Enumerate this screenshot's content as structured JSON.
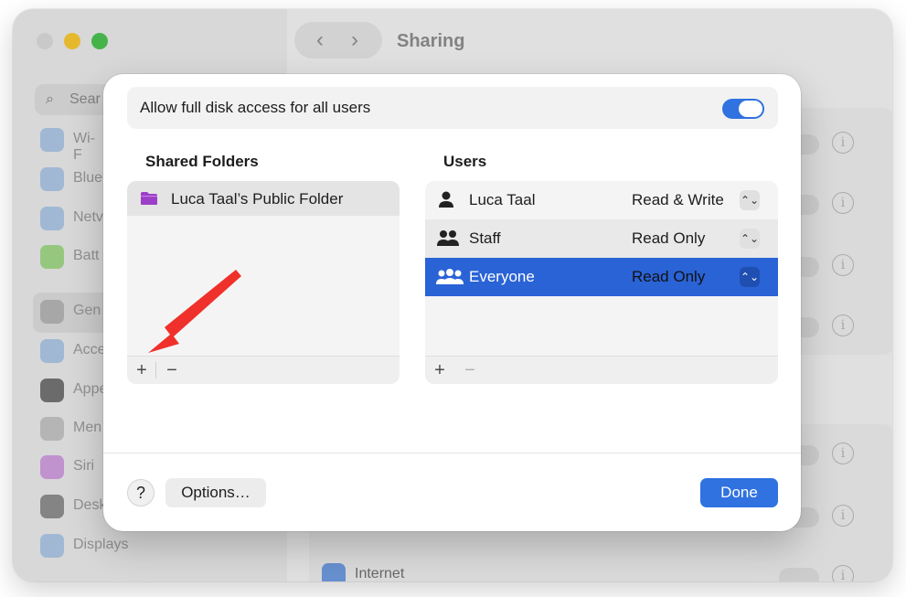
{
  "window": {
    "title": "Sharing",
    "nav_back": "‹",
    "nav_forward": "›",
    "search_placeholder": "Sear"
  },
  "sidebar": {
    "items": [
      {
        "label": "Wi-F",
        "icon": "wifi-icon"
      },
      {
        "label": "Blue",
        "icon": "bluetooth-icon"
      },
      {
        "label": "Netv",
        "icon": "network-icon"
      },
      {
        "label": "Batt",
        "icon": "battery-icon"
      },
      {
        "label": "Gen",
        "icon": "general-icon"
      },
      {
        "label": "Acce",
        "icon": "accessibility-icon"
      },
      {
        "label": "Appe",
        "icon": "appearance-icon"
      },
      {
        "label": "Men",
        "icon": "menu-bar-icon"
      },
      {
        "label": "Siri",
        "icon": "siri-icon"
      },
      {
        "label": "Desk",
        "icon": "desktop-icon"
      },
      {
        "label": "Displays",
        "icon": "displays-icon"
      }
    ]
  },
  "background": {
    "internet_sharing_label": "Internet Sharing"
  },
  "sheet": {
    "full_disk_access_label": "Allow full disk access for all users",
    "full_disk_access_on": true,
    "shared_folders_header": "Shared Folders",
    "users_header": "Users",
    "folders": [
      {
        "name": "Luca Taal’s Public Folder"
      }
    ],
    "users": [
      {
        "name": "Luca Taal",
        "permission": "Read & Write",
        "icon": "single-user-icon"
      },
      {
        "name": "Staff",
        "permission": "Read Only",
        "icon": "group-icon"
      },
      {
        "name": "Everyone",
        "permission": "Read Only",
        "icon": "everyone-icon",
        "selected": true
      }
    ],
    "add_label": "+",
    "remove_label": "−",
    "stepper_label": "⌃⌄",
    "help_label": "?",
    "options_label": "Options…",
    "done_label": "Done"
  },
  "colors": {
    "accent": "#2f72e0",
    "selection": "#2a63d6",
    "annotation_arrow": "#f0302b",
    "folder_purple": "#9b3fc8"
  }
}
